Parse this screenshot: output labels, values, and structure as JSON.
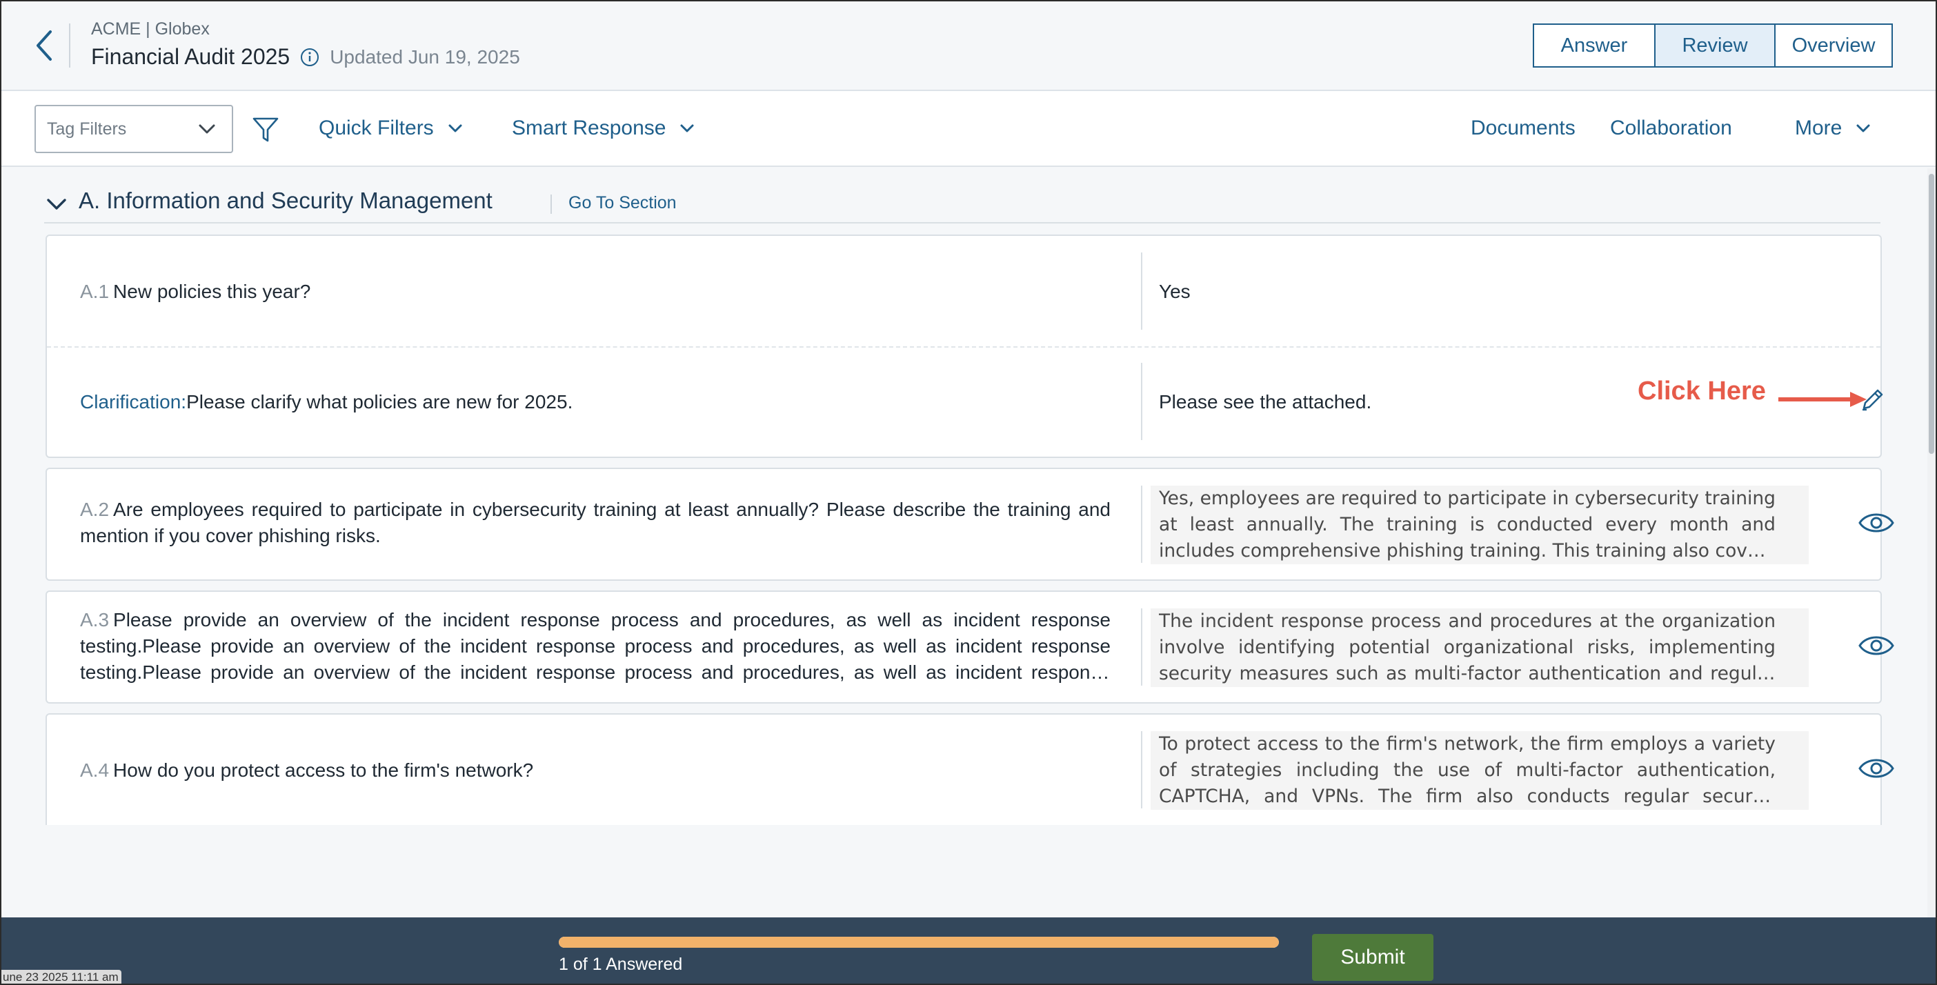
{
  "header": {
    "org": "ACME | Globex",
    "title": "Financial Audit 2025",
    "updated": "Updated Jun 19, 2025",
    "modes": [
      {
        "label": "Answer",
        "active": false
      },
      {
        "label": "Review",
        "active": true
      },
      {
        "label": "Overview",
        "active": false
      }
    ]
  },
  "toolbar": {
    "tag_filter_placeholder": "Tag Filters",
    "quick_filters": "Quick Filters",
    "smart_response": "Smart Response",
    "documents": "Documents",
    "collaboration": "Collaboration",
    "more": "More"
  },
  "section": {
    "title": "A. Information and Security Management",
    "goto": "Go To Section"
  },
  "questions": [
    {
      "num": "A.1",
      "text": "New policies this year?",
      "answer": "Yes",
      "clarification": {
        "label": "Clarification:",
        "text": "Please clarify what policies are new for 2025.",
        "answer": "Please see the attached."
      }
    },
    {
      "num": "A.2",
      "text": "Are employees required to participate in cybersecurity training at least annually? Please describe the training and mention if you cover phishing risks.",
      "answer": "Yes, employees are required to participate in cybersecurity training at least annually. The training is conducted every month and includes comprehensive phishing training. This training also covers how to identify and report suspicious emails."
    },
    {
      "num": "A.3",
      "text": "Please provide an overview of the incident response process and procedures, as well as incident response testing.Please provide an overview of the incident response process and procedures, as well as incident response testing.Please provide an overview of the incident response process and procedures, as well as incident response testing.",
      "answer": "The incident response process and procedures at the organization involve identifying potential organizational risks, implementing security measures such as multi-factor authentication and regular incident response testing."
    },
    {
      "num": "A.4",
      "text": "How do you protect access to the firm's network?",
      "answer": "To protect access to the firm's network, the firm employs a variety of strategies including the use of multi-factor authentication, CAPTCHA, and VPNs. The firm also conducts regular security reviews."
    }
  ],
  "annotation": {
    "callout": "Click Here",
    "color": "#e65b4a"
  },
  "footer": {
    "progress_fraction": 1.0,
    "progress_label": "1 of 1 Answered",
    "submit": "Submit",
    "timestamp": "une 23 2025 11:11 am"
  },
  "colors": {
    "accent": "#1f5f8b",
    "footer_bg": "#33475b",
    "progress": "#f2b26a",
    "submit": "#4e7a3a"
  }
}
